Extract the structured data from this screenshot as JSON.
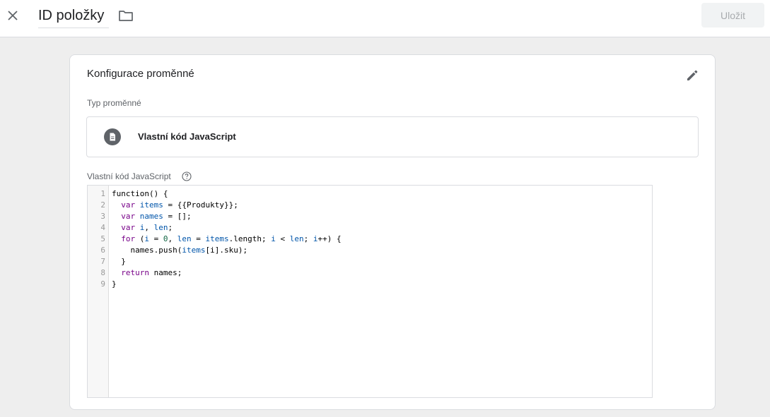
{
  "header": {
    "title": "ID položky",
    "save_label": "Uložit",
    "close_icon": "close-icon",
    "folder_icon": "folder-icon"
  },
  "config": {
    "title": "Konfigurace proměnné",
    "edit_icon": "pencil-icon",
    "type_label": "Typ proměnné",
    "type_name": "Vlastní kód JavaScript",
    "type_icon": "document-icon",
    "code_label": "Vlastní kód JavaScript",
    "help_icon": "help-icon"
  },
  "editor": {
    "line_numbers": [
      "1",
      "2",
      "3",
      "4",
      "5",
      "6",
      "7",
      "8",
      "9"
    ],
    "lines": [
      "function() {",
      "  var items = {{Produkty}};",
      "  var names = [];",
      "  var i, len;",
      "  for (i = 0, len = items.length; i < len; i++) {",
      "    names.push(items[i].sku);",
      "  }",
      "  return names;",
      "}"
    ]
  },
  "colors": {
    "keyword": "#770088",
    "variable": "#0055aa",
    "number": "#116644",
    "save_disabled_bg": "#f1f3f4",
    "save_disabled_text": "#a8abae"
  }
}
